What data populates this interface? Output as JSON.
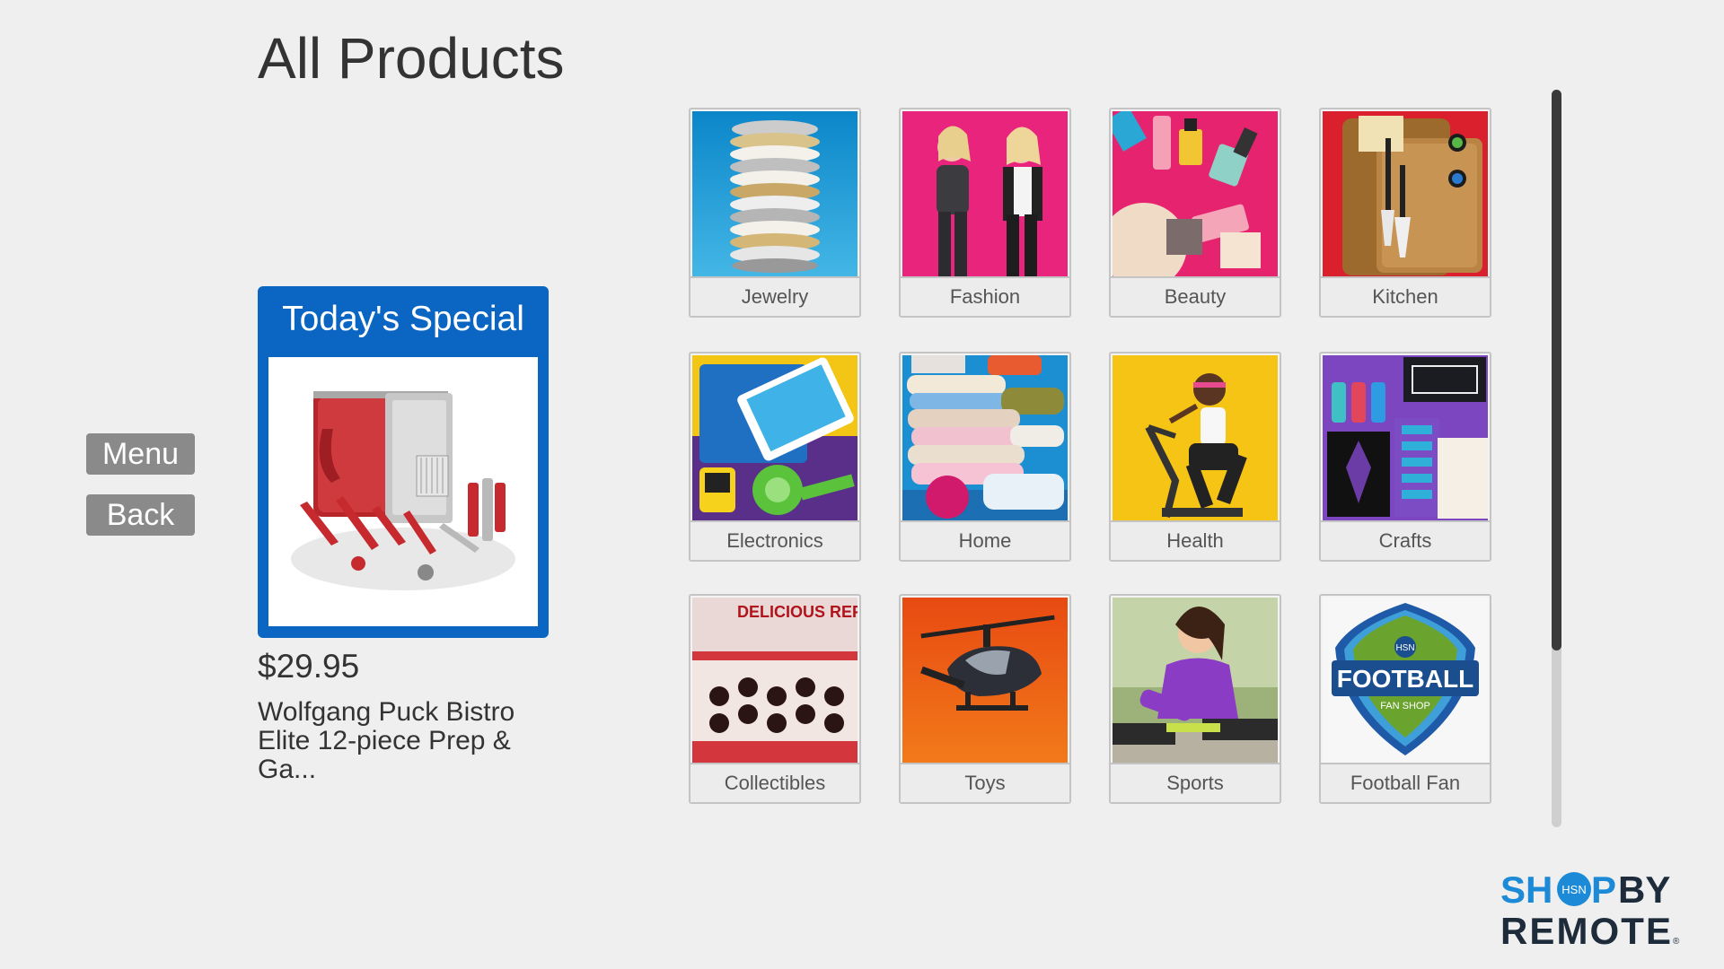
{
  "page": {
    "title": "All Products"
  },
  "nav": {
    "menu_label": "Menu",
    "back_label": "Back"
  },
  "special": {
    "header": "Today's Special",
    "price": "$29.95",
    "product_name": "Wolfgang Puck Bistro Elite 12-piece Prep & Ga..."
  },
  "categories": [
    {
      "label": "Jewelry"
    },
    {
      "label": "Fashion"
    },
    {
      "label": "Beauty"
    },
    {
      "label": "Kitchen"
    },
    {
      "label": "Electronics"
    },
    {
      "label": "Home"
    },
    {
      "label": "Health"
    },
    {
      "label": "Crafts"
    },
    {
      "label": "Collectibles",
      "image_text": "DELICIOUS REFRESHIN"
    },
    {
      "label": "Toys"
    },
    {
      "label": "Sports"
    },
    {
      "label": "Football Fan",
      "image_text": "FOOTBALL",
      "image_subtext": "FAN SHOP",
      "badge": "HSN"
    }
  ],
  "logo": {
    "line1_a": "SH",
    "line1_b": "P",
    "line1_c": "BY",
    "line2": "REMOTE",
    "badge": "HSN",
    "mark": "®"
  },
  "scroll": {
    "position_fraction": 0.0,
    "visible_fraction": 0.76
  },
  "colors": {
    "accent": "#0a66c2",
    "logo_blue": "#1c8ad6",
    "logo_dark": "#1d2b3a",
    "button_gray": "#8a8a8a"
  },
  "icons": [
    "hsn-logo-icon",
    "scroll-thumb"
  ]
}
